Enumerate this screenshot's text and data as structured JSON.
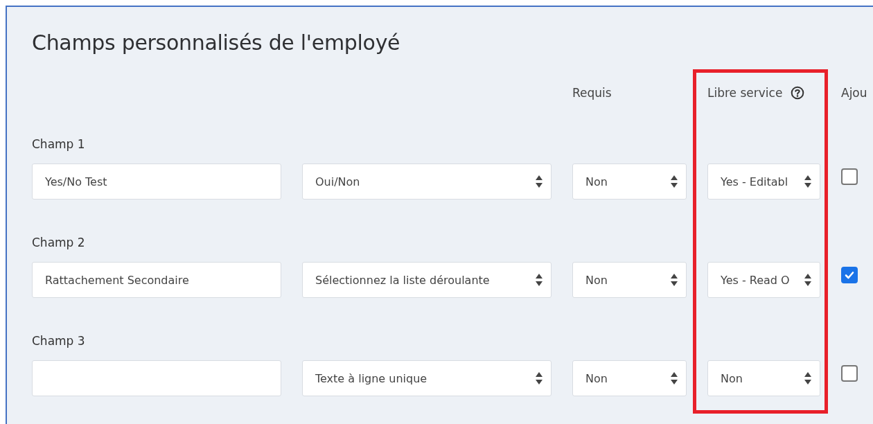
{
  "title": "Champs personnalisés de l'employé",
  "columns": [
    {
      "label": "Requis",
      "highlighted": false,
      "help": false
    },
    {
      "label": "Libre service",
      "highlighted": true,
      "help": true
    },
    {
      "label": "Ajou",
      "highlighted": false,
      "help": false
    }
  ],
  "fields": [
    {
      "label": "Champ 1",
      "name": "Yes/No Test",
      "type": "Oui/Non",
      "required": "Non",
      "self_service": "Yes - Editabl",
      "add": false
    },
    {
      "label": "Champ 2",
      "name": "Rattachement Secondaire",
      "type": "Sélectionnez la liste déroulante",
      "required": "Non",
      "self_service": "Yes - Read O",
      "add": true
    },
    {
      "label": "Champ 3",
      "type": "Texte à ligne unique",
      "required": "Non",
      "self_service": "Non",
      "add": false
    }
  ]
}
